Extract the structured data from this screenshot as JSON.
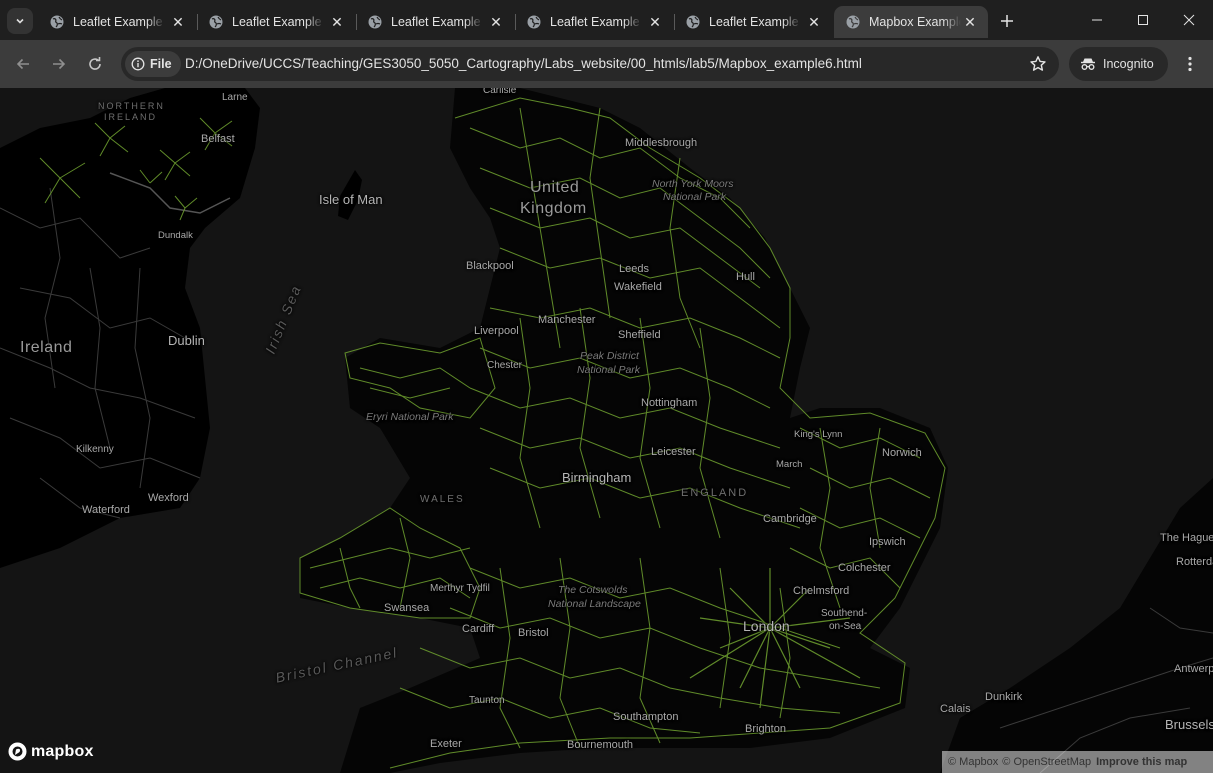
{
  "browser": {
    "tabs": [
      {
        "title": "Leaflet Example",
        "active": false
      },
      {
        "title": "Leaflet Example",
        "active": false
      },
      {
        "title": "Leaflet Example",
        "active": false
      },
      {
        "title": "Leaflet Example",
        "active": false
      },
      {
        "title": "Leaflet Example",
        "active": false
      },
      {
        "title": "Mapbox Example",
        "active": true
      }
    ],
    "site_chip": "File",
    "url": "D:/OneDrive/UCCS/Teaching/GES3050_5050_Cartography/Labs_website/00_htmls/lab5/Mapbox_example6.html",
    "incognito_label": "Incognito"
  },
  "map": {
    "network_color": "#6a9a2e",
    "labels": {
      "northern_ireland_1": "NORTHERN",
      "northern_ireland_2": "IRELAND",
      "larne": "Larne",
      "belfast": "Belfast",
      "dundalk": "Dundalk",
      "isle_of_man": "Isle of Man",
      "uk_1": "United",
      "uk_2": "Kingdom",
      "ireland": "Ireland",
      "dublin": "Dublin",
      "kilkenny": "Kilkenny",
      "wexford": "Wexford",
      "waterford": "Waterford",
      "irish_sea": "Irish Sea",
      "bristol_channel": "Bristol Channel",
      "carlisle": "Carlisle",
      "middlesbrough": "Middlesbrough",
      "north_york_moors_1": "North York Moors",
      "north_york_moors_2": "National Park",
      "blackpool": "Blackpool",
      "leeds": "Leeds",
      "wakefield": "Wakefield",
      "hull": "Hull",
      "liverpool": "Liverpool",
      "manchester": "Manchester",
      "sheffield": "Sheffield",
      "chester": "Chester",
      "peak_district_1": "Peak District",
      "peak_district_2": "National Park",
      "eryri": "Eryri National Park",
      "nottingham": "Nottingham",
      "kings_lynn": "King's Lynn",
      "norwich": "Norwich",
      "leicester": "Leicester",
      "birmingham": "Birmingham",
      "wales": "WALES",
      "england": "ENGLAND",
      "march": "March",
      "cambridge": "Cambridge",
      "ipswich": "Ipswich",
      "colchester": "Colchester",
      "chelmsford": "Chelmsford",
      "southend_1": "Southend-",
      "southend_2": "on-Sea",
      "london": "London",
      "swansea": "Swansea",
      "merthyr": "Merthyr Tydfil",
      "cardiff": "Cardiff",
      "bristol": "Bristol",
      "cotswolds_1": "The Cotswolds",
      "cotswolds_2": "National Landscape",
      "taunton": "Taunton",
      "southampton": "Southampton",
      "brighton": "Brighton",
      "exeter": "Exeter",
      "bournemouth": "Bournemouth",
      "the_hague": "The Hague",
      "rotterdam": "Rotterdam",
      "dunkirk": "Dunkirk",
      "calais": "Calais",
      "antwerp": "Antwerp",
      "brussels": "Brussels"
    },
    "logo": "mapbox",
    "attribution": {
      "mapbox": "© Mapbox",
      "osm": "© OpenStreetMap",
      "improve": "Improve this map"
    }
  }
}
